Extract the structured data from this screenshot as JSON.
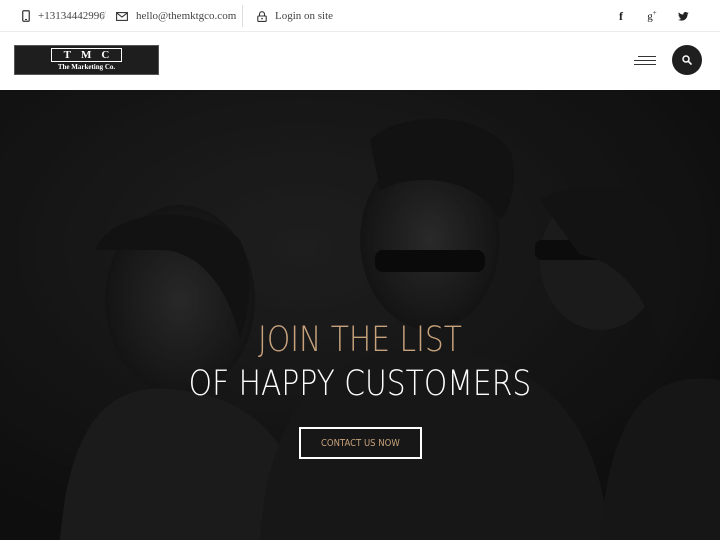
{
  "topbar": {
    "phone": "+13134442996",
    "email": "hello@themktgco.com",
    "login": "Login on site",
    "social": [
      {
        "icon": "facebook-icon",
        "glyph": "f"
      },
      {
        "icon": "google-plus-icon",
        "glyph": "g+"
      },
      {
        "icon": "twitter-icon",
        "glyph": "t"
      }
    ]
  },
  "header": {
    "logo_mark": "TMC",
    "logo_sub": "The Marketing Co."
  },
  "hero": {
    "title_line1": "JOIN THE LIST",
    "title_line2": "OF HAPPY CUSTOMERS",
    "cta_label": "CONTACT US NOW"
  },
  "colors": {
    "accent": "#c7a27c",
    "hero_bg": "#161616",
    "search_button_bg": "#1f1f1f"
  }
}
